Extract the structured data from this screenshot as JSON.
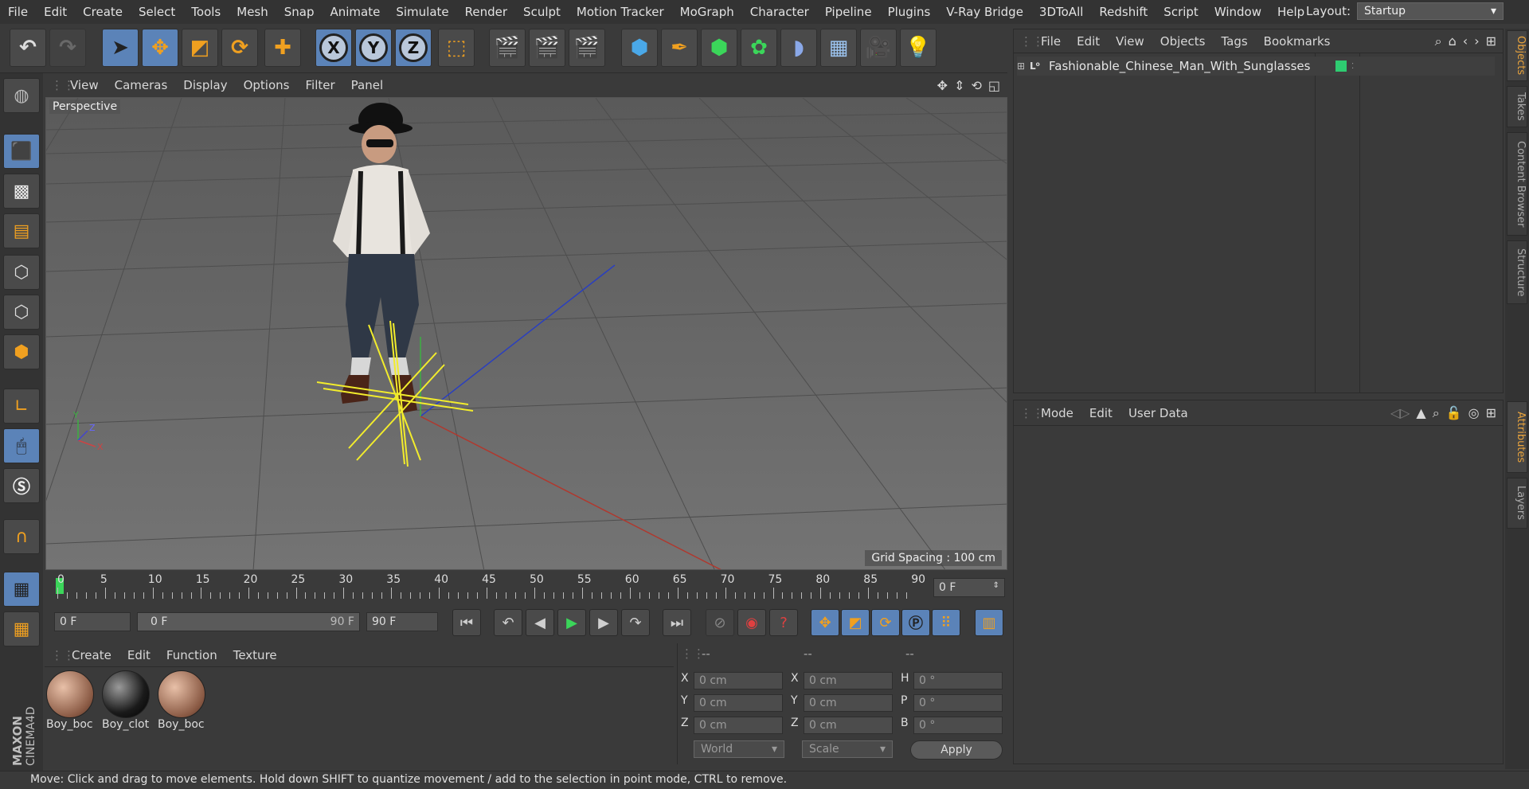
{
  "menubar": {
    "items": [
      "File",
      "Edit",
      "Create",
      "Select",
      "Tools",
      "Mesh",
      "Snap",
      "Animate",
      "Simulate",
      "Render",
      "Sculpt",
      "Motion Tracker",
      "MoGraph",
      "Character",
      "Pipeline",
      "Plugins",
      "V-Ray Bridge",
      "3DToAll",
      "Redshift",
      "Script",
      "Window",
      "Help"
    ],
    "layout_label": "Layout:",
    "layout_value": "Startup"
  },
  "toolbar": {
    "axis_x": "X",
    "axis_y": "Y",
    "axis_z": "Z"
  },
  "viewport": {
    "menu": [
      "View",
      "Cameras",
      "Display",
      "Options",
      "Filter",
      "Panel"
    ],
    "label": "Perspective",
    "grid_spacing": "Grid Spacing : 100 cm"
  },
  "timeline": {
    "ticks": [
      "0",
      "5",
      "10",
      "15",
      "20",
      "25",
      "30",
      "35",
      "40",
      "45",
      "50",
      "55",
      "60",
      "65",
      "70",
      "75",
      "80",
      "85",
      "90"
    ],
    "current_frame": "0 F"
  },
  "playbar": {
    "start_frame": "0 F",
    "range_start": "0 F",
    "range_end": "90 F",
    "end_frame": "90 F"
  },
  "materials": {
    "menu": [
      "Create",
      "Edit",
      "Function",
      "Texture"
    ],
    "items": [
      {
        "label": "Boy_boc"
      },
      {
        "label": "Boy_clot"
      },
      {
        "label": "Boy_boc"
      }
    ]
  },
  "coords": {
    "headers": [
      "--",
      "--",
      "--"
    ],
    "rows": [
      {
        "l1": "X",
        "v1": "0 cm",
        "l2": "X",
        "v2": "0 cm",
        "l3": "H",
        "v3": "0 °"
      },
      {
        "l1": "Y",
        "v1": "0 cm",
        "l2": "Y",
        "v2": "0 cm",
        "l3": "P",
        "v3": "0 °"
      },
      {
        "l1": "Z",
        "v1": "0 cm",
        "l2": "Z",
        "v2": "0 cm",
        "l3": "B",
        "v3": "0 °"
      }
    ],
    "world": "World",
    "scale": "Scale",
    "apply": "Apply"
  },
  "objects": {
    "menu": [
      "File",
      "Edit",
      "View",
      "Objects",
      "Tags",
      "Bookmarks"
    ],
    "row_name": "Fashionable_Chinese_Man_With_Sunglasses",
    "row_tag_color": "#2ecc71"
  },
  "attributes": {
    "menu": [
      "Mode",
      "Edit",
      "User Data"
    ]
  },
  "sidetabs": {
    "top": [
      "Objects",
      "Takes",
      "Content Browser",
      "Structure"
    ],
    "bottom": [
      "Attributes",
      "Layers"
    ]
  },
  "branding": {
    "logo": "MAXON CINEMA 4D"
  },
  "status": {
    "text": "Move: Click and drag to move elements. Hold down SHIFT to quantize movement / add to the selection in point mode, CTRL to remove."
  },
  "colors": {
    "accent": "#5b83b8",
    "tab_active": "#e8a33d",
    "play_green": "#3bd65a"
  }
}
